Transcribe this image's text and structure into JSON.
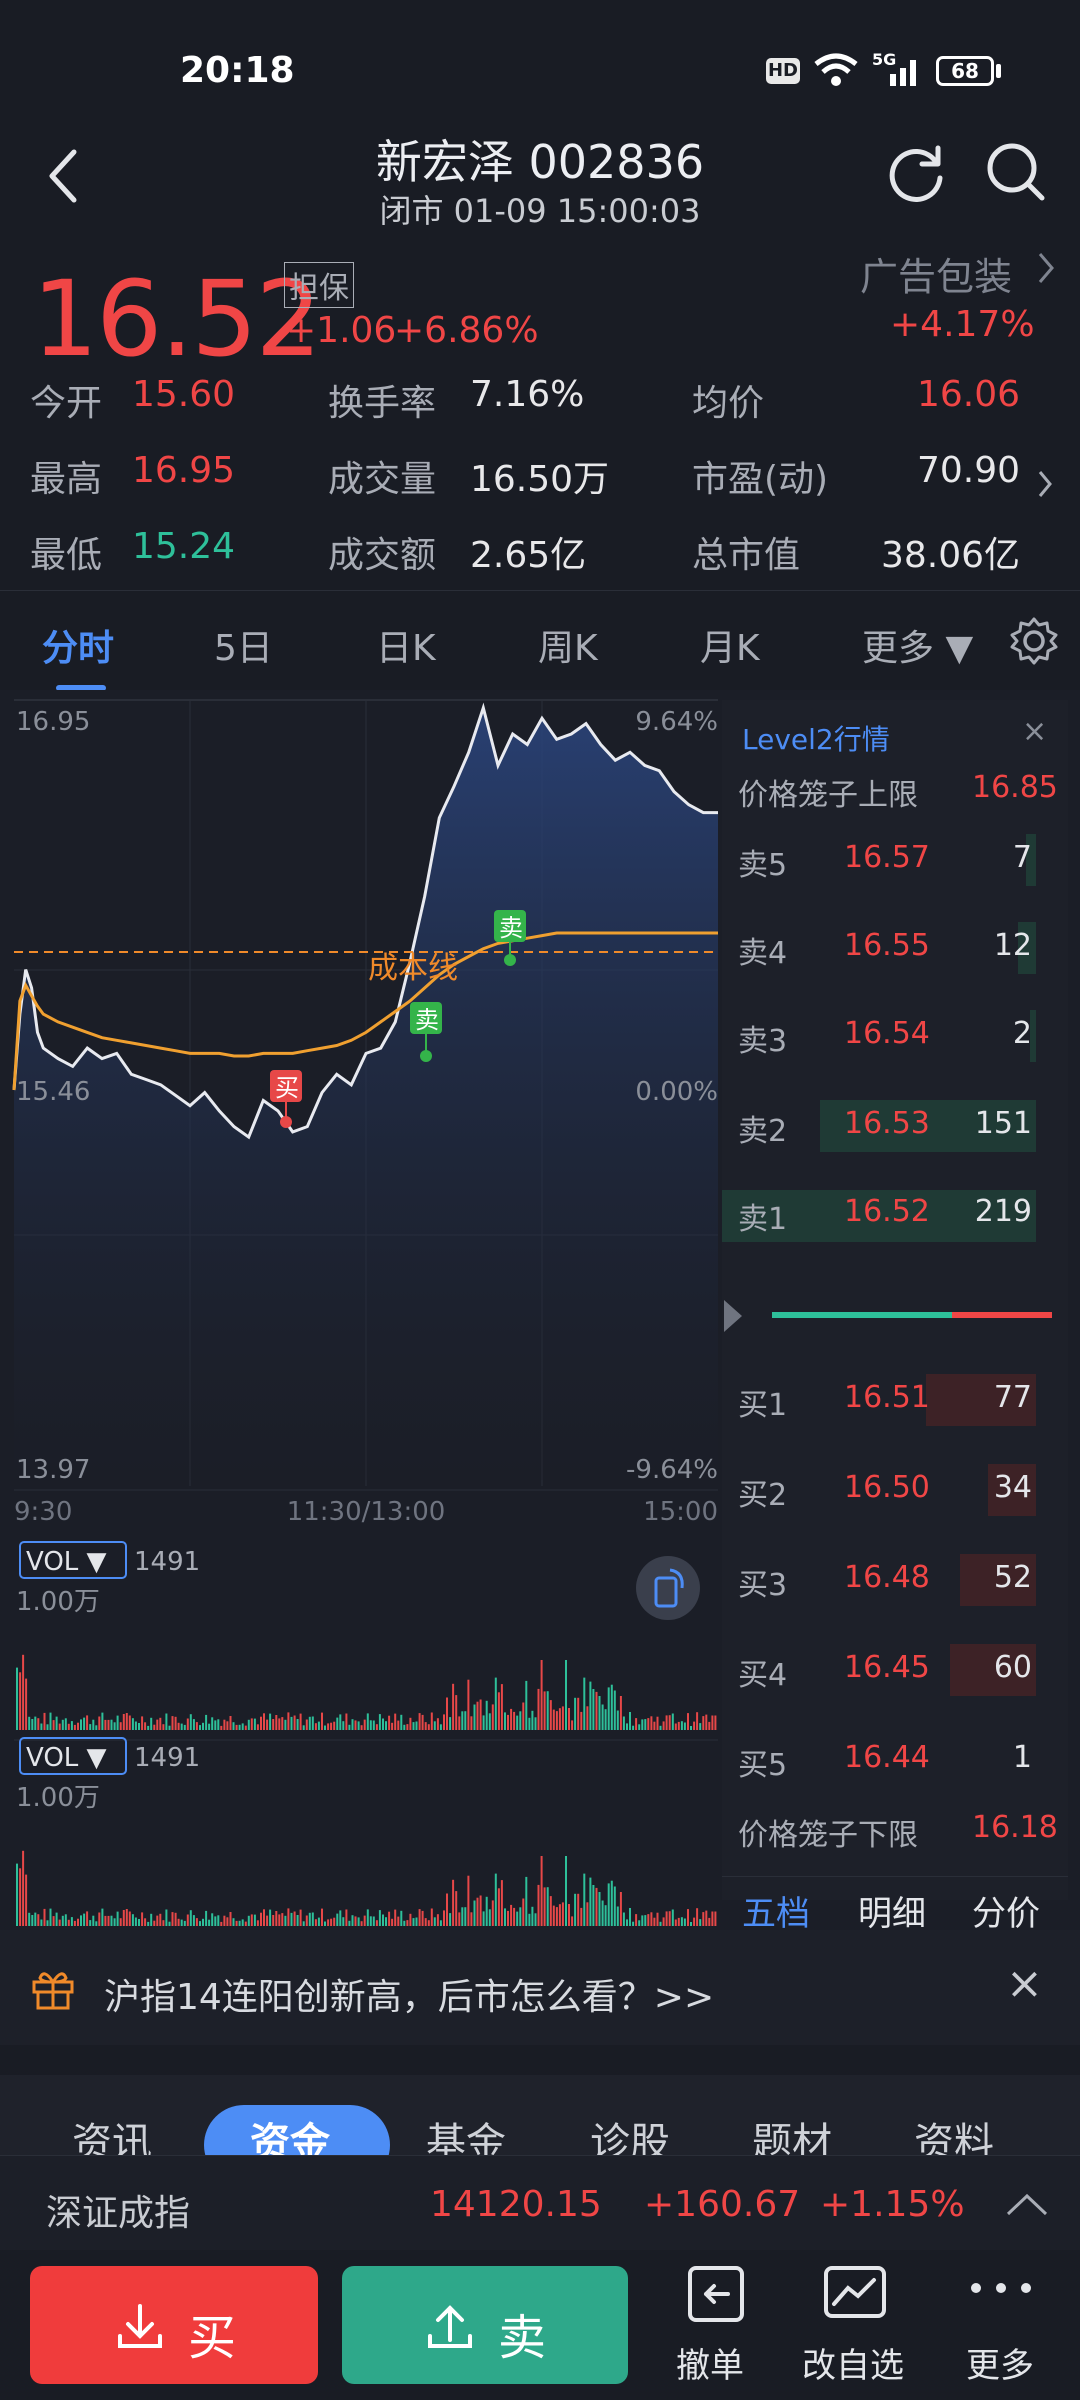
{
  "status": {
    "time": "20:18",
    "hd": "HD",
    "net": "5G",
    "battery": "68"
  },
  "header": {
    "title": "新宏泽 002836",
    "subtitle": "闭市 01-09 15:00:03"
  },
  "quote": {
    "price": "16.52",
    "tag": "担保",
    "change": "+1.06",
    "change_pct": "+6.86%",
    "sector": {
      "name": "广告包装",
      "pct": "+4.17%"
    },
    "stats": [
      {
        "label": "今开",
        "value": "15.60",
        "color": "red"
      },
      {
        "label": "换手率",
        "value": "7.16%",
        "color": "white"
      },
      {
        "label": "均价",
        "value": "16.06",
        "color": "red"
      },
      {
        "label": "最高",
        "value": "16.95",
        "color": "red"
      },
      {
        "label": "成交量",
        "value": "16.50万",
        "color": "white"
      },
      {
        "label": "市盈(动)",
        "value": "70.90",
        "color": "white"
      },
      {
        "label": "最低",
        "value": "15.24",
        "color": "green"
      },
      {
        "label": "成交额",
        "value": "2.65亿",
        "color": "white"
      },
      {
        "label": "总市值",
        "value": "38.06亿",
        "color": "white"
      }
    ]
  },
  "tabs": [
    {
      "label": "分时",
      "active": true
    },
    {
      "label": "5日"
    },
    {
      "label": "日K"
    },
    {
      "label": "周K"
    },
    {
      "label": "月K"
    },
    {
      "label": "更多 ▼"
    }
  ],
  "chart": {
    "y_top": "16.95",
    "y_mid": "15.46",
    "y_bot": "13.97",
    "pct_top": "9.64%",
    "pct_mid": "0.00%",
    "pct_bot": "-9.64%",
    "x_start": "9:30",
    "x_mid": "11:30/13:00",
    "x_end": "15:00",
    "cost_line": "成本线",
    "buy_mark": "买",
    "sell_mark": "卖",
    "vol_label": "VOL ▼",
    "vol_value": "1491",
    "vol_scale": "1.00万"
  },
  "chart_data": {
    "type": "line",
    "title": "",
    "x_range": [
      "9:30",
      "15:00"
    ],
    "ylim": [
      13.97,
      16.95
    ],
    "series": [],
    "x": [
      0,
      2,
      4,
      6,
      8,
      10,
      15,
      20,
      25,
      30,
      35,
      40,
      45,
      50,
      55,
      60,
      65,
      70,
      75,
      80,
      85,
      90,
      95,
      100,
      105,
      110,
      115,
      120,
      125,
      130,
      135,
      140,
      145,
      150,
      155,
      160,
      165,
      170,
      175,
      180,
      185,
      190,
      195,
      200,
      205,
      210,
      215,
      220,
      225,
      230,
      235,
      240
    ],
    "price": [
      15.46,
      15.75,
      15.92,
      15.85,
      15.68,
      15.62,
      15.58,
      15.55,
      15.62,
      15.58,
      15.6,
      15.52,
      15.5,
      15.48,
      15.44,
      15.4,
      15.45,
      15.38,
      15.32,
      15.28,
      15.42,
      15.38,
      15.3,
      15.32,
      15.45,
      15.52,
      15.48,
      15.6,
      15.62,
      15.72,
      15.95,
      16.2,
      16.5,
      16.62,
      16.75,
      16.92,
      16.7,
      16.82,
      16.78,
      16.88,
      16.8,
      16.82,
      16.86,
      16.78,
      16.72,
      16.75,
      16.7,
      16.68,
      16.6,
      16.55,
      16.52,
      16.52
    ],
    "avg": [
      15.46,
      15.8,
      15.86,
      15.82,
      15.78,
      15.75,
      15.72,
      15.7,
      15.68,
      15.66,
      15.65,
      15.64,
      15.63,
      15.62,
      15.61,
      15.6,
      15.6,
      15.6,
      15.59,
      15.59,
      15.6,
      15.6,
      15.6,
      15.61,
      15.62,
      15.63,
      15.65,
      15.68,
      15.72,
      15.76,
      15.8,
      15.85,
      15.9,
      15.94,
      15.97,
      16.0,
      16.02,
      16.03,
      16.04,
      16.05,
      16.06,
      16.06,
      16.06,
      16.06,
      16.06,
      16.06,
      16.06,
      16.06,
      16.06,
      16.06,
      16.06,
      16.06
    ]
  },
  "orderbook": {
    "title": "Level2行情",
    "upper_label": "价格笼子上限",
    "upper_value": "16.85",
    "lower_label": "价格笼子下限",
    "lower_value": "16.18",
    "sells": [
      {
        "label": "卖5",
        "price": "16.57",
        "vol": "7"
      },
      {
        "label": "卖4",
        "price": "16.55",
        "vol": "12"
      },
      {
        "label": "卖3",
        "price": "16.54",
        "vol": "2"
      },
      {
        "label": "卖2",
        "price": "16.53",
        "vol": "151"
      },
      {
        "label": "卖1",
        "price": "16.52",
        "vol": "219"
      }
    ],
    "buys": [
      {
        "label": "买1",
        "price": "16.51",
        "vol": "77"
      },
      {
        "label": "买2",
        "price": "16.50",
        "vol": "34"
      },
      {
        "label": "买3",
        "price": "16.48",
        "vol": "52"
      },
      {
        "label": "买4",
        "price": "16.45",
        "vol": "60"
      },
      {
        "label": "买5",
        "price": "16.44",
        "vol": "1"
      }
    ],
    "footer": [
      "五档",
      "明细",
      "分价"
    ]
  },
  "banner": {
    "text": "沪指14连阳创新高，后市怎么看？>>"
  },
  "bottom_tabs": [
    "资讯",
    "资金",
    "基金",
    "诊股",
    "题材",
    "资料"
  ],
  "index": {
    "name": "深证成指",
    "value": "14120.15",
    "change": "+160.67",
    "pct": "+1.15%"
  },
  "actions": {
    "buy": "买",
    "sell": "卖",
    "cancel": "撤单",
    "edit": "改自选",
    "more": "更多"
  },
  "colors": {
    "up": "#f04646",
    "down": "#2ec09a",
    "accent": "#4d8df5",
    "avg_line": "#f0a030",
    "bg": "#191c24"
  }
}
